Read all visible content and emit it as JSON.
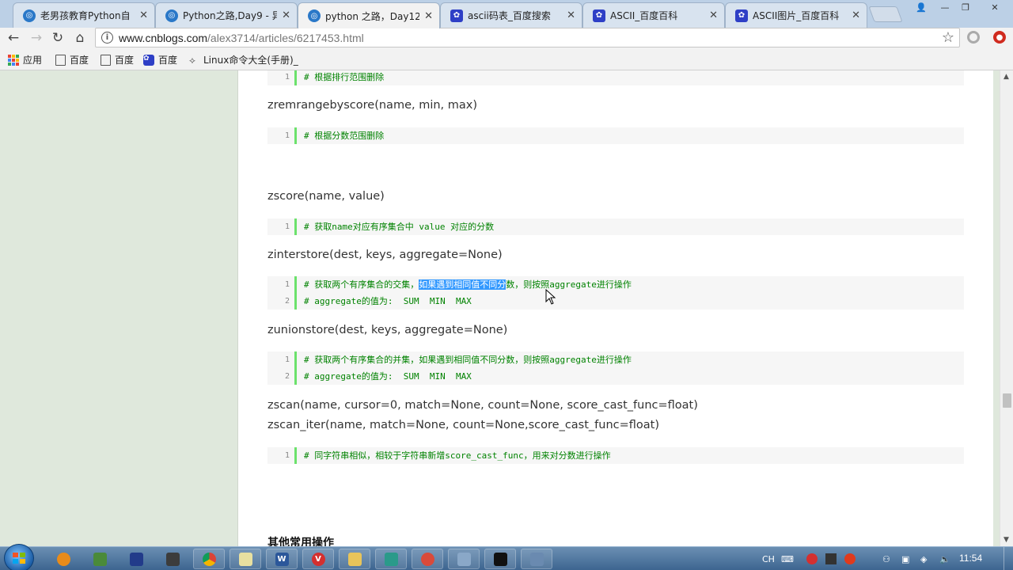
{
  "browser": {
    "tabs": [
      {
        "title": "老男孩教育Python自",
        "icon": "cnblogs-icon",
        "active": false
      },
      {
        "title": "Python之路,Day9 - 异",
        "icon": "cnblogs-icon",
        "active": false
      },
      {
        "title": "python 之路，Day12",
        "icon": "cnblogs-icon",
        "active": true
      },
      {
        "title": "ascii码表_百度搜索",
        "icon": "baidu-paw-icon",
        "active": false
      },
      {
        "title": "ASCII_百度百科",
        "icon": "baidu-paw-icon",
        "active": false
      },
      {
        "title": "ASCII图片_百度百科",
        "icon": "baidu-paw-icon",
        "active": false
      }
    ],
    "close_glyph": "✕",
    "url_host": "www.cnblogs.com",
    "url_path": "/alex3714/articles/6217453.html",
    "bookmarks": [
      {
        "label": "应用",
        "icon": "apps-grid-icon"
      },
      {
        "label": "百度",
        "icon": "page-icon"
      },
      {
        "label": "百度",
        "icon": "page-icon"
      },
      {
        "label": "百度",
        "icon": "baidu-paw-icon"
      },
      {
        "label": "Linux命令大全(手册)_",
        "icon": "linux-icon"
      }
    ]
  },
  "article": {
    "blocks": [
      {
        "type": "code",
        "lines": [
          "# 根据排行范围删除"
        ]
      },
      {
        "type": "sig",
        "text": "zremrangebyscore(name, min, max)"
      },
      {
        "type": "code",
        "lines": [
          "# 根据分数范围删除"
        ]
      },
      {
        "type": "sig",
        "text": "zscore(name, value)"
      },
      {
        "type": "code",
        "lines": [
          "# 获取name对应有序集合中 value 对应的分数"
        ]
      },
      {
        "type": "sig",
        "text": "zinterstore(dest, keys, aggregate=None)"
      },
      {
        "type": "code",
        "lines": [
          "# 获取两个有序集合的交集，",
          "# aggregate的值为:  SUM  MIN  MAX"
        ],
        "selection": {
          "before": "# 获取两个有序集合的交集，",
          "selected": "如果遇到相同值不同分",
          "after": "数，则按照aggregate进行操作"
        }
      },
      {
        "type": "sig",
        "text": "zunionstore(dest, keys, aggregate=None)"
      },
      {
        "type": "code",
        "lines": [
          "# 获取两个有序集合的并集，如果遇到相同值不同分数，则按照aggregate进行操作",
          "# aggregate的值为:  SUM  MIN  MAX"
        ]
      },
      {
        "type": "sig",
        "text": "zscan(name, cursor=0, match=None, count=None, score_cast_func=float)"
      },
      {
        "type": "sig",
        "text": "zscan_iter(name, match=None, count=None,score_cast_func=float)"
      },
      {
        "type": "code",
        "lines": [
          "# 同字符串相似，相较于字符串新增score_cast_func，用来对分数进行操作"
        ]
      }
    ],
    "heading": "其他常用操作"
  },
  "taskbar": {
    "clock": "11:54",
    "ime": "CH",
    "apps": [
      "firefox-icon",
      "network-icon",
      "save-icon",
      "tools-icon",
      "chrome-icon",
      "notepad-icon",
      "word-icon",
      "vivaldi-icon",
      "explorer-icon",
      "app-icon",
      "paint-icon",
      "brush-icon",
      "cmd-icon",
      "window-icon"
    ]
  },
  "colors": {
    "code_text": "#008200",
    "code_bar": "#6ce26c",
    "selection": "#3399ff",
    "side_band": "#dfe8dc"
  }
}
